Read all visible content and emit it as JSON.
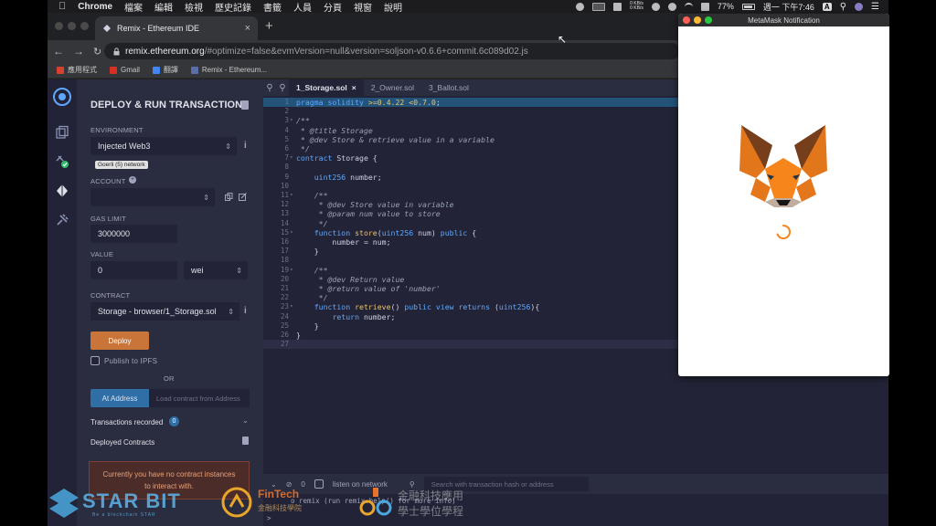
{
  "menubar": {
    "app": "Chrome",
    "menus": [
      "檔案",
      "編輯",
      "檢視",
      "歷史記錄",
      "書籤",
      "人員",
      "分頁",
      "視窗",
      "說明"
    ],
    "net_up": "0 KB/s",
    "net_down": "0 KB/s",
    "battery": "77%",
    "clock": "週一 下午7:46",
    "input_method": "A"
  },
  "browser": {
    "tab_title": "Remix - Ethereum IDE",
    "url_host": "remix.ethereum.org",
    "url_path": "/#optimize=false&evmVersion=null&version=soljson-v0.6.6+commit.6c089d02.js",
    "bookmarks": [
      {
        "label": "應用程式",
        "color": "#d8412f"
      },
      {
        "label": "Gmail",
        "color": "#d93025"
      },
      {
        "label": "翻譯",
        "color": "#4285f4"
      },
      {
        "label": "Remix - Ethereum...",
        "color": "#5a6fa8"
      }
    ]
  },
  "deploy_panel": {
    "title": "DEPLOY & RUN TRANSACTIONS",
    "environment_label": "ENVIRONMENT",
    "environment_value": "Injected Web3",
    "network_badge": "Goerli (5) network",
    "account_label": "ACCOUNT",
    "account_value": "",
    "gas_limit_label": "GAS LIMIT",
    "gas_limit_value": "3000000",
    "value_label": "VALUE",
    "value_amount": "0",
    "value_unit": "wei",
    "contract_label": "CONTRACT",
    "contract_value": "Storage - browser/1_Storage.sol",
    "deploy_button": "Deploy",
    "publish_ipfs": "Publish to IPFS",
    "or_text": "OR",
    "at_address_button": "At Address",
    "load_placeholder": "Load contract from Address",
    "transactions_recorded": "Transactions recorded",
    "transactions_count": "0",
    "deployed_contracts": "Deployed Contracts",
    "no_instances_line1": "Currently you have no contract instances",
    "no_instances_line2": "to interact with."
  },
  "editor": {
    "tabs": [
      "1_Storage.sol",
      "2_Owner.sol",
      "3_Ballot.sol"
    ],
    "active_tab": "1_Storage.sol",
    "lines": [
      "pragma solidity >=0.4.22 <0.7.0;",
      "",
      "/**",
      " * @title Storage",
      " * @dev Store & retrieve value in a variable",
      " */",
      "contract Storage {",
      "",
      "    uint256 number;",
      "",
      "    /**",
      "     * @dev Store value in variable",
      "     * @param num value to store",
      "     */",
      "    function store(uint256 num) public {",
      "        number = num;",
      "    }",
      "",
      "    /**",
      "     * @dev Return value",
      "     * @return value of 'number'",
      "     */",
      "    function retrieve() public view returns (uint256){",
      "        return number;",
      "    }",
      "}",
      ""
    ],
    "terminal_count": "0",
    "listen_label": "listen on network",
    "search_placeholder": "Search with transaction hash or address",
    "terminal_line": "o remix (run remix.help() for more info)",
    "terminal_prompt": ">"
  },
  "metamask": {
    "title": "MetaMask Notification"
  },
  "watermarks": {
    "starbit": "STAR BIT",
    "starbit_sub": "Be a blockchain STAR",
    "fintech": "FinTech",
    "fintech_sub": "金融科技學院",
    "school_line1": "金融科技應用",
    "school_line2": "學士學位學程"
  }
}
